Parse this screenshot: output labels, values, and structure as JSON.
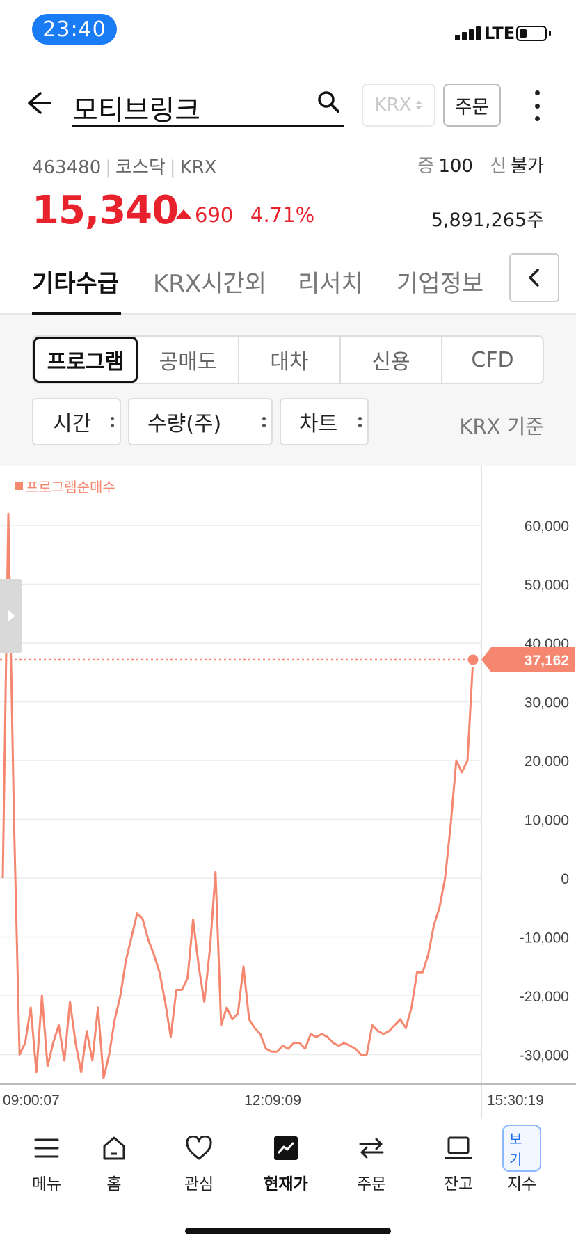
{
  "status_bar": {
    "time": "23:40",
    "network": "LTE"
  },
  "header": {
    "title": "모티브링크",
    "market_select": "KRX",
    "order_button": "주문"
  },
  "stock": {
    "code": "463480",
    "market": "코스닥",
    "exchange": "KRX",
    "margin_label": "증",
    "margin_value": "100",
    "credit_label": "신",
    "credit_value": "불가",
    "price": "15,340",
    "change": "690",
    "change_pct": "4.71%",
    "volume": "5,891,265주",
    "up_color": "#e8222d"
  },
  "tabs": [
    {
      "label": "기타수급",
      "active": true
    },
    {
      "label": "KRX시간외"
    },
    {
      "label": "리서치"
    },
    {
      "label": "기업정보"
    }
  ],
  "segments": [
    "프로그램",
    "공매도",
    "대차",
    "신용",
    "CFD"
  ],
  "filters": {
    "time": "시간",
    "unit": "수량(주)",
    "view": "차트",
    "basis": "KRX 기준"
  },
  "chart_data": {
    "type": "line",
    "legend": "프로그램순매수",
    "series_color": "#f58770",
    "current_value": "37,162",
    "x_ticks": [
      "09:00:07",
      "12:09:09",
      "15:30:19"
    ],
    "y_ticks": [
      "60,000",
      "50,000",
      "40,000",
      "30,000",
      "20,000",
      "10,000",
      "0",
      "-10,000",
      "-20,000",
      "-30,000"
    ],
    "ylim": [
      -34000,
      64000
    ],
    "grid": true,
    "series": [
      {
        "values": [
          0,
          62000,
          10000,
          -30000,
          -28000,
          -22000,
          -33000,
          -20000,
          -32000,
          -28000,
          -25000,
          -31000,
          -21000,
          -28000,
          -33000,
          -26000,
          -31000,
          -22000,
          -34000,
          -30000,
          -24000,
          -20000,
          -14000,
          -10000,
          -6000,
          -7000,
          -10500,
          -13000,
          -16000,
          -21000,
          -27000,
          -19000,
          -19000,
          -17000,
          -7000,
          -15000,
          -21000,
          -12000,
          1000,
          -25000,
          -22000,
          -24000,
          -23000,
          -15000,
          -24000,
          -25500,
          -26500,
          -29000,
          -29500,
          -29500,
          -28500,
          -29000,
          -28000,
          -28000,
          -29000,
          -26500,
          -27000,
          -26500,
          -27000,
          -28000,
          -28500,
          -28000,
          -28500,
          -29000,
          -30000,
          -30000,
          -25000,
          -26000,
          -26500,
          -26000,
          -25000,
          -24000,
          -25500,
          -22000,
          -16000,
          -16000,
          -13000,
          -8000,
          -5000,
          0,
          9000,
          20000,
          18000,
          20000,
          37162
        ]
      }
    ]
  },
  "bottom_nav": [
    {
      "label": "메뉴",
      "icon": "menu-icon"
    },
    {
      "label": "홈",
      "icon": "home-icon"
    },
    {
      "label": "관심",
      "icon": "heart-icon"
    },
    {
      "label": "현재가",
      "icon": "chart-icon",
      "active": true
    },
    {
      "label": "주문",
      "icon": "transfer-icon"
    },
    {
      "label": "잔고",
      "icon": "laptop-icon"
    },
    {
      "label": "지수",
      "icon": "index-icon",
      "badge": "보기"
    }
  ]
}
